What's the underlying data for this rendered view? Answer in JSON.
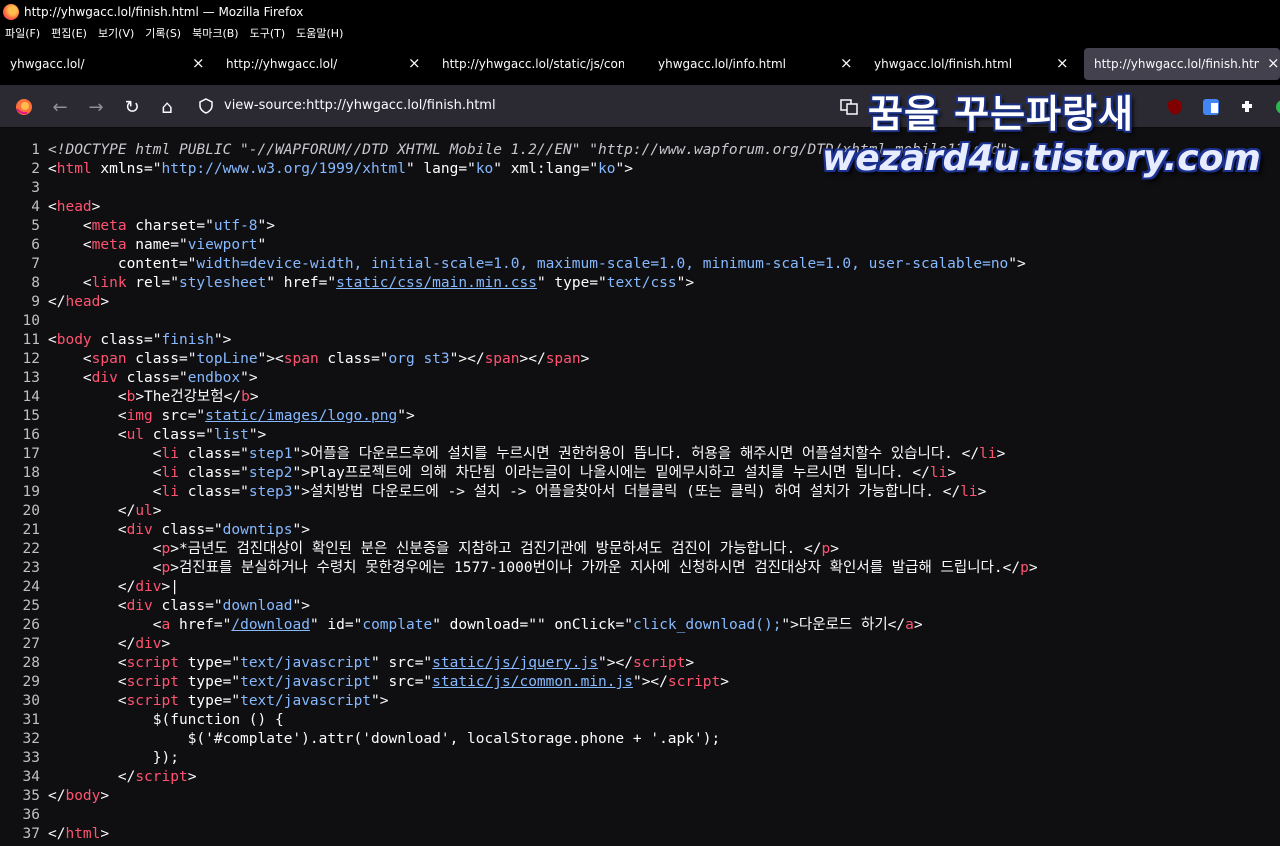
{
  "window": {
    "title": "http://yhwgacc.lol/finish.html — Mozilla Firefox"
  },
  "menu": [
    "파일(F)",
    "편집(E)",
    "보기(V)",
    "기록(S)",
    "북마크(B)",
    "도구(T)",
    "도움말(H)"
  ],
  "tabs": [
    {
      "label": "yhwgacc.lol/",
      "active": false
    },
    {
      "label": "http://yhwgacc.lol/",
      "active": false
    },
    {
      "label": "http://yhwgacc.lol/static/js/comm",
      "active": false
    },
    {
      "label": "yhwgacc.lol/info.html",
      "active": false
    },
    {
      "label": "yhwgacc.lol/finish.html",
      "active": false
    },
    {
      "label": "http://yhwgacc.lol/finish.html",
      "active": true
    }
  ],
  "icons": {
    "close": "×",
    "back": "←",
    "forward": "→",
    "reload": "↻",
    "home": "⌂"
  },
  "urlbar": {
    "url": "view-source:http://yhwgacc.lol/finish.html"
  },
  "watermark": {
    "line1": "꿈을 꾸는파랑새",
    "line2": "wezard4u.tistory.com"
  },
  "source_lines": [
    [
      [
        "d",
        "<!DOCTYPE html PUBLIC \"-//WAPFORUM//DTD XHTML Mobile 1.2//EN\" \"http://www.wapforum.org/DTD/xhtml-mobile12.dtd\">"
      ]
    ],
    [
      [
        "p",
        "<"
      ],
      [
        "t",
        "html"
      ],
      [
        "a",
        " xmlns"
      ],
      [
        "p",
        "=\""
      ],
      [
        "v",
        "http://www.w3.org/1999/xhtml"
      ],
      [
        "p",
        "\""
      ],
      [
        "a",
        " lang"
      ],
      [
        "p",
        "=\""
      ],
      [
        "v",
        "ko"
      ],
      [
        "p",
        "\""
      ],
      [
        "a",
        " xml:lang"
      ],
      [
        "p",
        "=\""
      ],
      [
        "v",
        "ko"
      ],
      [
        "p",
        "\">"
      ]
    ],
    [],
    [
      [
        "p",
        "<"
      ],
      [
        "t",
        "head"
      ],
      [
        "p",
        ">"
      ]
    ],
    [
      [
        "x",
        "    "
      ],
      [
        "p",
        "<"
      ],
      [
        "t",
        "meta"
      ],
      [
        "a",
        " charset"
      ],
      [
        "p",
        "=\""
      ],
      [
        "v",
        "utf-8"
      ],
      [
        "p",
        "\">"
      ]
    ],
    [
      [
        "x",
        "    "
      ],
      [
        "p",
        "<"
      ],
      [
        "t",
        "meta"
      ],
      [
        "a",
        " name"
      ],
      [
        "p",
        "=\""
      ],
      [
        "v",
        "viewport"
      ],
      [
        "p",
        "\""
      ]
    ],
    [
      [
        "x",
        "        "
      ],
      [
        "a",
        "content"
      ],
      [
        "p",
        "=\""
      ],
      [
        "v",
        "width=device-width, initial-scale=1.0, maximum-scale=1.0, minimum-scale=1.0, user-scalable=no"
      ],
      [
        "p",
        "\">"
      ]
    ],
    [
      [
        "x",
        "    "
      ],
      [
        "p",
        "<"
      ],
      [
        "t",
        "link"
      ],
      [
        "a",
        " rel"
      ],
      [
        "p",
        "=\""
      ],
      [
        "v",
        "stylesheet"
      ],
      [
        "p",
        "\""
      ],
      [
        "a",
        " href"
      ],
      [
        "p",
        "=\""
      ],
      [
        "l",
        "static/css/main.min.css"
      ],
      [
        "p",
        "\""
      ],
      [
        "a",
        " type"
      ],
      [
        "p",
        "=\""
      ],
      [
        "v",
        "text/css"
      ],
      [
        "p",
        "\">"
      ]
    ],
    [
      [
        "p",
        "</"
      ],
      [
        "t",
        "head"
      ],
      [
        "p",
        ">"
      ]
    ],
    [],
    [
      [
        "p",
        "<"
      ],
      [
        "t",
        "body"
      ],
      [
        "a",
        " class"
      ],
      [
        "p",
        "=\""
      ],
      [
        "v",
        "finish"
      ],
      [
        "p",
        "\">"
      ]
    ],
    [
      [
        "x",
        "    "
      ],
      [
        "p",
        "<"
      ],
      [
        "t",
        "span"
      ],
      [
        "a",
        " class"
      ],
      [
        "p",
        "=\""
      ],
      [
        "v",
        "topLine"
      ],
      [
        "p",
        "\"><"
      ],
      [
        "t",
        "span"
      ],
      [
        "a",
        " class"
      ],
      [
        "p",
        "=\""
      ],
      [
        "v",
        "org st3"
      ],
      [
        "p",
        "\"></"
      ],
      [
        "t",
        "span"
      ],
      [
        "p",
        "></"
      ],
      [
        "t",
        "span"
      ],
      [
        "p",
        ">"
      ]
    ],
    [
      [
        "x",
        "    "
      ],
      [
        "p",
        "<"
      ],
      [
        "t",
        "div"
      ],
      [
        "a",
        " class"
      ],
      [
        "p",
        "=\""
      ],
      [
        "v",
        "endbox"
      ],
      [
        "p",
        "\">"
      ]
    ],
    [
      [
        "x",
        "        "
      ],
      [
        "p",
        "<"
      ],
      [
        "t",
        "b"
      ],
      [
        "p",
        ">"
      ],
      [
        "x",
        "The건강보험"
      ],
      [
        "p",
        "</"
      ],
      [
        "t",
        "b"
      ],
      [
        "p",
        ">"
      ]
    ],
    [
      [
        "x",
        "        "
      ],
      [
        "p",
        "<"
      ],
      [
        "t",
        "img"
      ],
      [
        "a",
        " src"
      ],
      [
        "p",
        "=\""
      ],
      [
        "l",
        "static/images/logo.png"
      ],
      [
        "p",
        "\">"
      ]
    ],
    [
      [
        "x",
        "        "
      ],
      [
        "p",
        "<"
      ],
      [
        "t",
        "ul"
      ],
      [
        "a",
        " class"
      ],
      [
        "p",
        "=\""
      ],
      [
        "v",
        "list"
      ],
      [
        "p",
        "\">"
      ]
    ],
    [
      [
        "x",
        "            "
      ],
      [
        "p",
        "<"
      ],
      [
        "t",
        "li"
      ],
      [
        "a",
        " class"
      ],
      [
        "p",
        "=\""
      ],
      [
        "v",
        "step1"
      ],
      [
        "p",
        "\">"
      ],
      [
        "x",
        "어플을 다운로드후에 설치를 누르시면 권한허용이 뜹니다. 허용을 해주시면 어플설치할수 있습니다. "
      ],
      [
        "p",
        "</"
      ],
      [
        "t",
        "li"
      ],
      [
        "p",
        ">"
      ]
    ],
    [
      [
        "x",
        "            "
      ],
      [
        "p",
        "<"
      ],
      [
        "t",
        "li"
      ],
      [
        "a",
        " class"
      ],
      [
        "p",
        "=\""
      ],
      [
        "v",
        "step2"
      ],
      [
        "p",
        "\">"
      ],
      [
        "x",
        "Play프로젝트에 의해 차단됨 이라는글이 나올시에는 밑에무시하고 설치를 누르시면 됩니다. "
      ],
      [
        "p",
        "</"
      ],
      [
        "t",
        "li"
      ],
      [
        "p",
        ">"
      ]
    ],
    [
      [
        "x",
        "            "
      ],
      [
        "p",
        "<"
      ],
      [
        "t",
        "li"
      ],
      [
        "a",
        " class"
      ],
      [
        "p",
        "=\""
      ],
      [
        "v",
        "step3"
      ],
      [
        "p",
        "\">"
      ],
      [
        "x",
        "설치방법 다운로드에 -> 설치 -> 어플을찾아서 더블클릭 (또는 클릭) 하여 설치가 가능합니다. "
      ],
      [
        "p",
        "</"
      ],
      [
        "t",
        "li"
      ],
      [
        "p",
        ">"
      ]
    ],
    [
      [
        "x",
        "        "
      ],
      [
        "p",
        "</"
      ],
      [
        "t",
        "ul"
      ],
      [
        "p",
        ">"
      ]
    ],
    [
      [
        "x",
        "        "
      ],
      [
        "p",
        "<"
      ],
      [
        "t",
        "div"
      ],
      [
        "a",
        " class"
      ],
      [
        "p",
        "=\""
      ],
      [
        "v",
        "downtips"
      ],
      [
        "p",
        "\">"
      ]
    ],
    [
      [
        "x",
        "            "
      ],
      [
        "p",
        "<"
      ],
      [
        "t",
        "p"
      ],
      [
        "p",
        ">"
      ],
      [
        "x",
        "*금년도 검진대상이 확인된 분은 신분증을 지참하고 검진기관에 방문하셔도 검진이 가능합니다. "
      ],
      [
        "p",
        "</"
      ],
      [
        "t",
        "p"
      ],
      [
        "p",
        ">"
      ]
    ],
    [
      [
        "x",
        "            "
      ],
      [
        "p",
        "<"
      ],
      [
        "t",
        "p"
      ],
      [
        "p",
        ">"
      ],
      [
        "x",
        "검진표를 분실하거나 수령치 못한경우에는 1577-1000번이나 가까운 지사에 신청하시면 검진대상자 확인서를 발급해 드립니다."
      ],
      [
        "p",
        "</"
      ],
      [
        "t",
        "p"
      ],
      [
        "p",
        ">"
      ]
    ],
    [
      [
        "x",
        "        "
      ],
      [
        "p",
        "</"
      ],
      [
        "t",
        "div"
      ],
      [
        "p",
        ">|"
      ]
    ],
    [
      [
        "x",
        "        "
      ],
      [
        "p",
        "<"
      ],
      [
        "t",
        "div"
      ],
      [
        "a",
        " class"
      ],
      [
        "p",
        "=\""
      ],
      [
        "v",
        "download"
      ],
      [
        "p",
        "\">"
      ]
    ],
    [
      [
        "x",
        "            "
      ],
      [
        "p",
        "<"
      ],
      [
        "t",
        "a"
      ],
      [
        "a",
        " href"
      ],
      [
        "p",
        "=\""
      ],
      [
        "l",
        "/download"
      ],
      [
        "p",
        "\""
      ],
      [
        "a",
        " id"
      ],
      [
        "p",
        "=\""
      ],
      [
        "v",
        "complate"
      ],
      [
        "p",
        "\""
      ],
      [
        "a",
        " download"
      ],
      [
        "p",
        "=\"\""
      ],
      [
        "a",
        " onClick"
      ],
      [
        "p",
        "=\""
      ],
      [
        "v",
        "click_download();"
      ],
      [
        "p",
        "\">"
      ],
      [
        "x",
        "다운로드 하기"
      ],
      [
        "p",
        "</"
      ],
      [
        "t",
        "a"
      ],
      [
        "p",
        ">"
      ]
    ],
    [
      [
        "x",
        "        "
      ],
      [
        "p",
        "</"
      ],
      [
        "t",
        "div"
      ],
      [
        "p",
        ">"
      ]
    ],
    [
      [
        "x",
        "        "
      ],
      [
        "p",
        "<"
      ],
      [
        "t",
        "script"
      ],
      [
        "a",
        " type"
      ],
      [
        "p",
        "=\""
      ],
      [
        "v",
        "text/javascript"
      ],
      [
        "p",
        "\""
      ],
      [
        "a",
        " src"
      ],
      [
        "p",
        "=\""
      ],
      [
        "l",
        "static/js/jquery.js"
      ],
      [
        "p",
        "\"></"
      ],
      [
        "t",
        "script"
      ],
      [
        "p",
        ">"
      ]
    ],
    [
      [
        "x",
        "        "
      ],
      [
        "p",
        "<"
      ],
      [
        "t",
        "script"
      ],
      [
        "a",
        " type"
      ],
      [
        "p",
        "=\""
      ],
      [
        "v",
        "text/javascript"
      ],
      [
        "p",
        "\""
      ],
      [
        "a",
        " src"
      ],
      [
        "p",
        "=\""
      ],
      [
        "l",
        "static/js/common.min.js"
      ],
      [
        "p",
        "\"></"
      ],
      [
        "t",
        "script"
      ],
      [
        "p",
        ">"
      ]
    ],
    [
      [
        "x",
        "        "
      ],
      [
        "p",
        "<"
      ],
      [
        "t",
        "script"
      ],
      [
        "a",
        " type"
      ],
      [
        "p",
        "=\""
      ],
      [
        "v",
        "text/javascript"
      ],
      [
        "p",
        "\">"
      ]
    ],
    [
      [
        "x",
        "            $(function () {"
      ]
    ],
    [
      [
        "x",
        "                $('#complate').attr('download', localStorage.phone + '.apk');"
      ]
    ],
    [
      [
        "x",
        "            });"
      ]
    ],
    [
      [
        "x",
        "        "
      ],
      [
        "p",
        "</"
      ],
      [
        "t",
        "script"
      ],
      [
        "p",
        ">"
      ]
    ],
    [
      [
        "p",
        "</"
      ],
      [
        "t",
        "body"
      ],
      [
        "p",
        ">"
      ]
    ],
    [],
    [
      [
        "p",
        "</"
      ],
      [
        "t",
        "html"
      ],
      [
        "p",
        ">"
      ]
    ]
  ]
}
